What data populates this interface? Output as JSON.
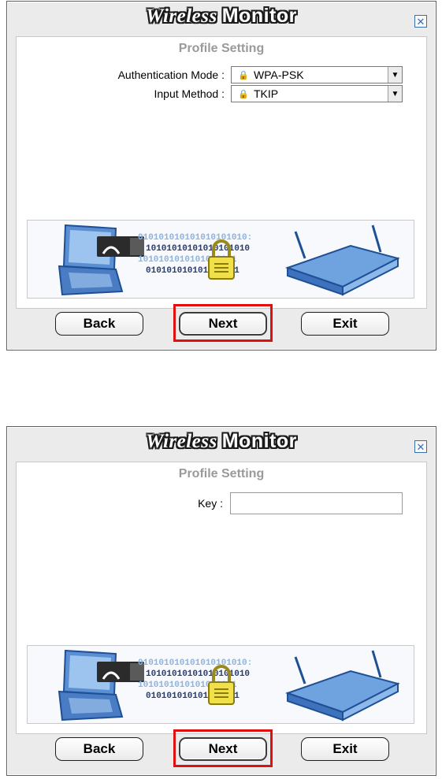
{
  "dialog": {
    "title_italic": "Wireless",
    "title_bold": "Monitor",
    "close_symbol": "✕",
    "subtitle": "Profile Setting"
  },
  "step1": {
    "auth_label": "Authentication Mode :",
    "auth_value": "WPA-PSK",
    "input_label": "Input Method :",
    "input_value": "TKIP"
  },
  "step2": {
    "key_label": "Key :",
    "key_value": ""
  },
  "buttons": {
    "back": "Back",
    "next": "Next",
    "exit": "Exit"
  },
  "banner": {
    "binary_rows": [
      "010101010101010101010:",
      "10101010101010101010",
      "1010101010101010101",
      "010101010101010101"
    ]
  },
  "colors": {
    "highlight": "#e01010",
    "bit_blue": "#8fb3dd",
    "bit_dark": "#2a3d6a"
  }
}
